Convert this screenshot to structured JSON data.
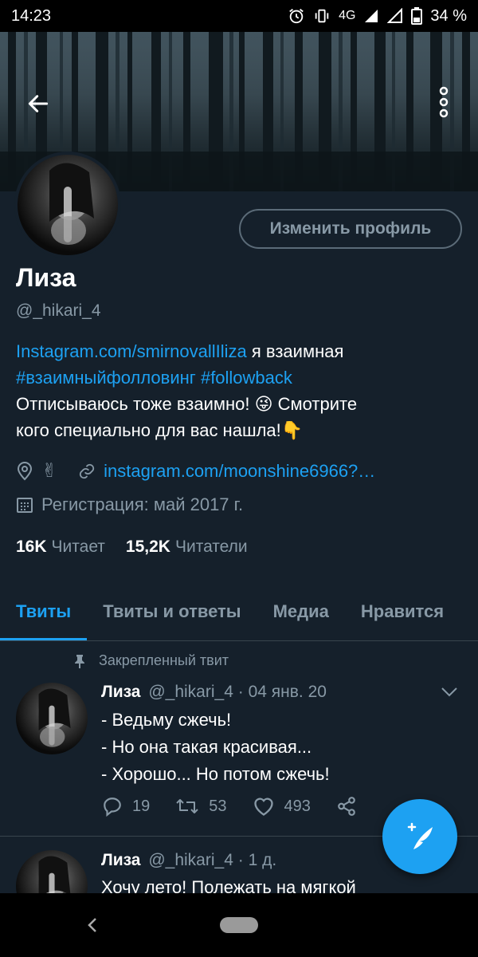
{
  "status_bar": {
    "time": "14:23",
    "network": "4G",
    "battery": "34 %"
  },
  "profile": {
    "edit_button": "Изменить профиль",
    "name": "Лиза",
    "handle": "@_hikari_4",
    "bio_link": "Instagram.com/smirnovallIliza",
    "bio_after_link": " я взаимная",
    "bio_hashtag_1": "#взаимныйфолловинг",
    "bio_hashtag_2": "#followback",
    "bio_line_3": "Отписываюсь тоже взаимно! 😜 Смотрите",
    "bio_line_4": "кого специально для вас нашла!👇",
    "location": "✌",
    "website": "instagram.com/moonshine6966?…",
    "joined": "Регистрация: май 2017 г.",
    "following_count": "16K",
    "following_label": "Читает",
    "followers_count": "15,2K",
    "followers_label": "Читатели"
  },
  "tabs": [
    {
      "label": "Твиты",
      "active": true
    },
    {
      "label": "Твиты и ответы",
      "active": false
    },
    {
      "label": "Медиа",
      "active": false
    },
    {
      "label": "Нравится",
      "active": false
    }
  ],
  "pinned_label": "Закрепленный твит",
  "tweets": [
    {
      "name": "Лиза",
      "handle": "@_hikari_4",
      "sep": "·",
      "date": "04 янв. 20",
      "lines": [
        "- Ведьму сжечь!",
        "- Но она такая красивая...",
        "- Хорошо... Но потом сжечь!"
      ],
      "replies": "19",
      "retweets": "53",
      "likes": "493"
    },
    {
      "name": "Лиза",
      "handle": "@_hikari_4",
      "sep": "·",
      "date": "1 д.",
      "lines": [
        "Хочу лето! Полежать на мягкой"
      ]
    }
  ],
  "colors": {
    "background": "#15202b",
    "accent": "#1da1f2",
    "secondary_text": "#8899a6",
    "divider": "#38444d"
  },
  "icons": [
    "back-arrow-icon",
    "more-vert-icon",
    "location-pin-icon",
    "link-icon",
    "calendar-icon",
    "pin-icon",
    "chevron-down-icon",
    "reply-icon",
    "retweet-icon",
    "like-icon",
    "share-icon",
    "compose-tweet-icon"
  ]
}
